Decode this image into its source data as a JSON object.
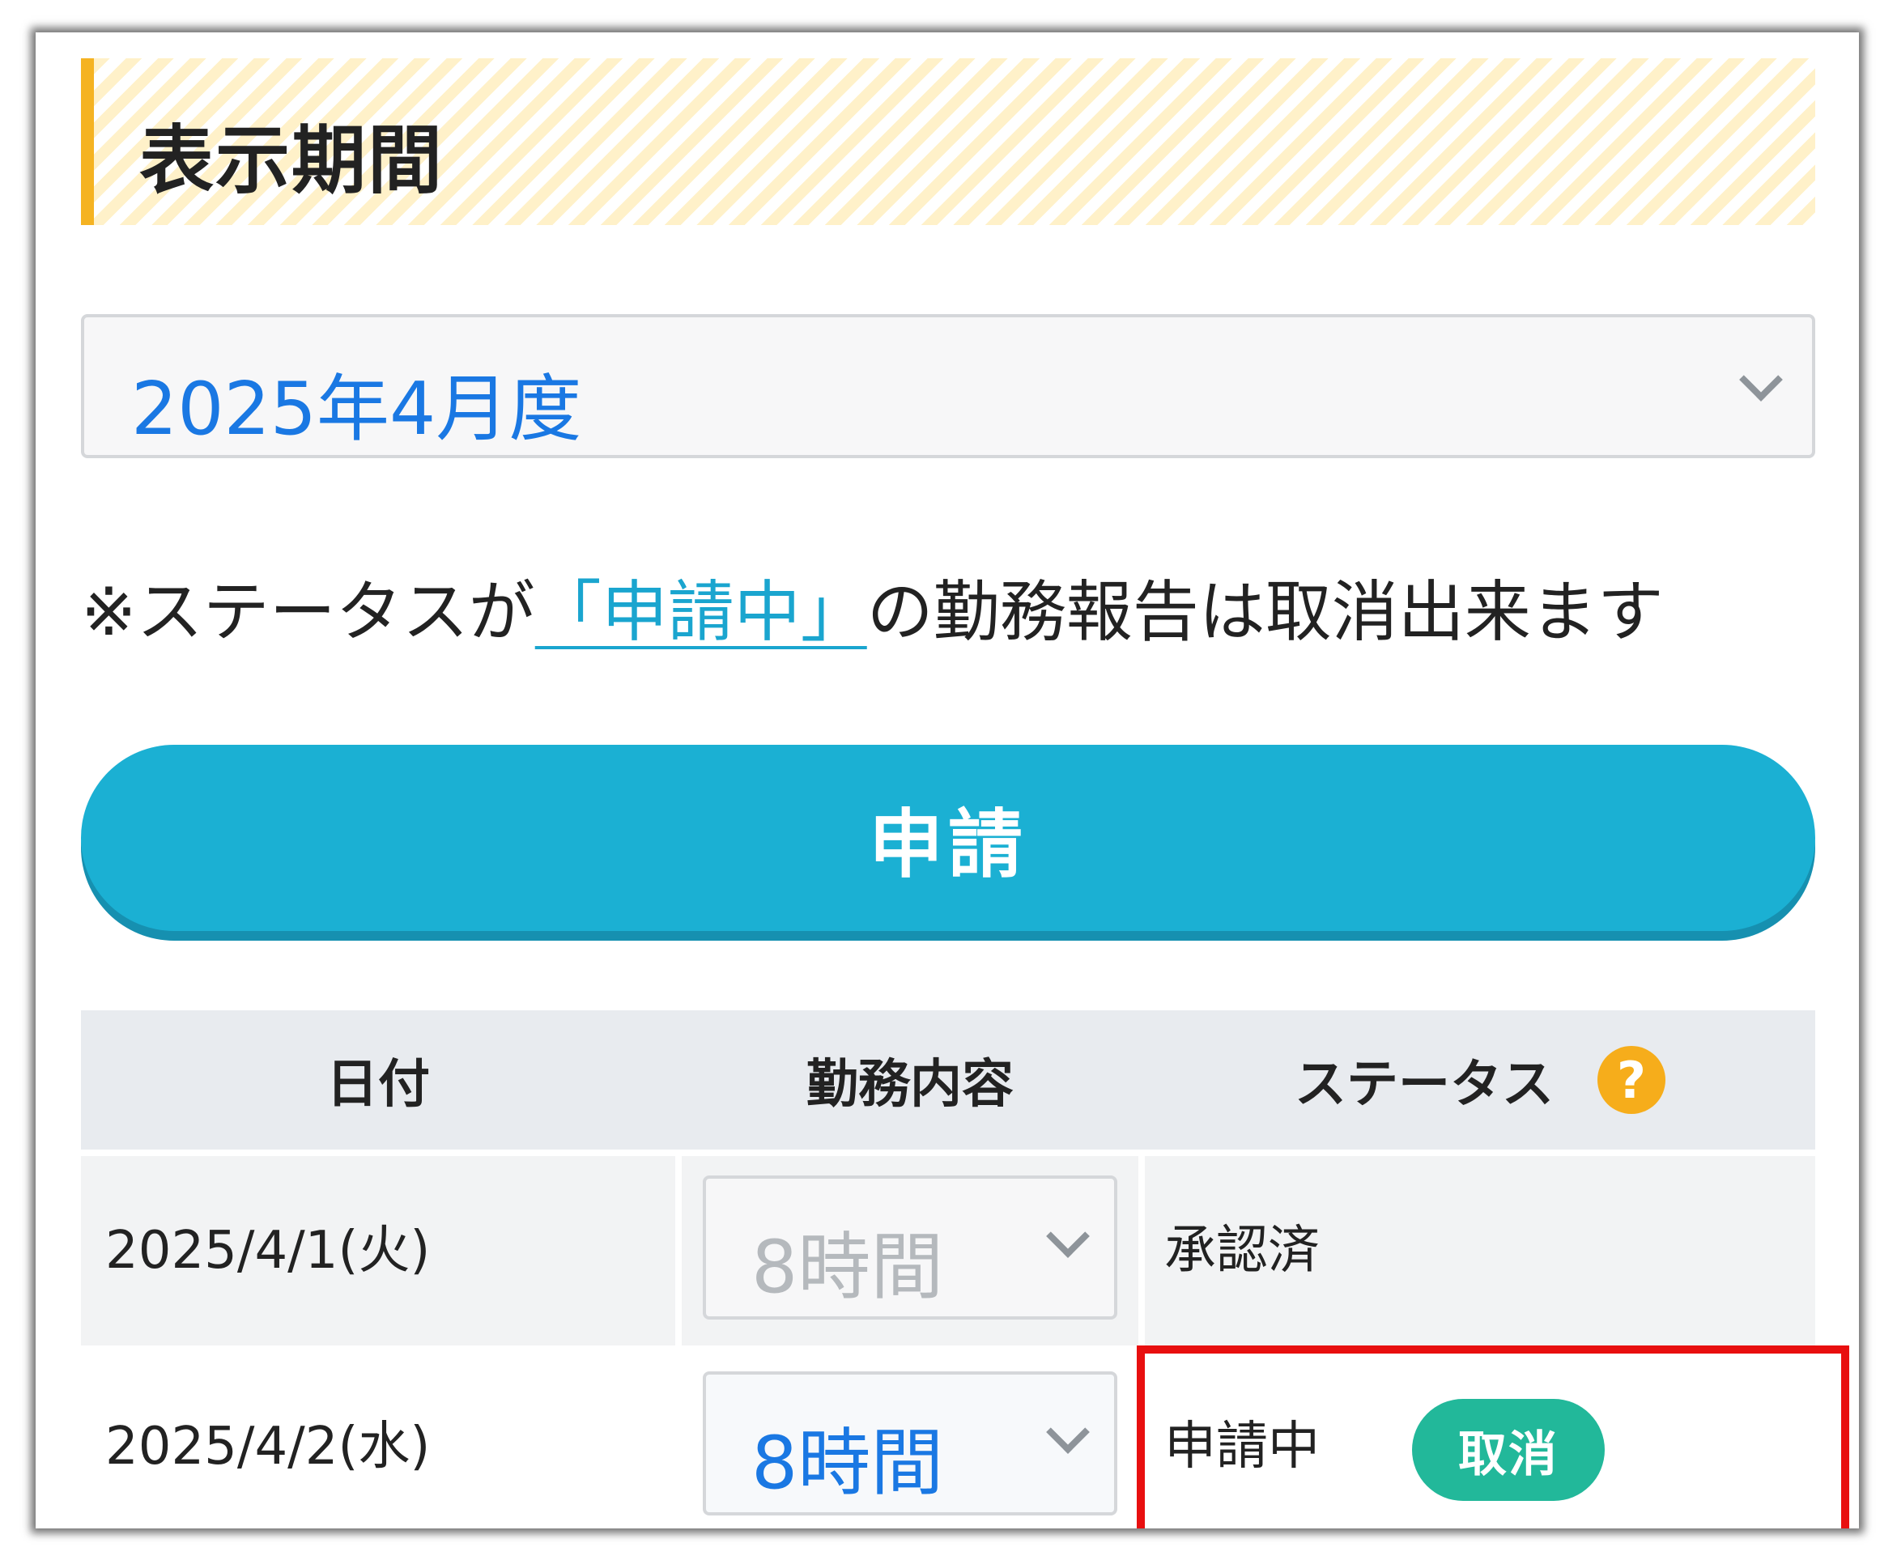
{
  "section": {
    "title": "表示期間"
  },
  "period_select": {
    "value": "2025年4月度"
  },
  "notice": {
    "prefix": "※ステータスが",
    "link": "「申請中」",
    "suffix": "の勤務報告は取消出来ます"
  },
  "apply_button": {
    "label": "申請"
  },
  "table": {
    "headers": {
      "date": "日付",
      "work": "勤務内容",
      "status": "ステータス",
      "help_icon": "?"
    },
    "rows": [
      {
        "date": "2025/4/1(火)",
        "hours": "8時間",
        "status": "承認済"
      },
      {
        "date": "2025/4/2(水)",
        "hours": "8時間",
        "status": "申請中",
        "action": "取消"
      }
    ]
  },
  "colors": {
    "accent_yellow": "#f5b322",
    "primary_blue": "#1bb0d3",
    "link_blue": "#1aa5cf",
    "select_text_blue": "#1a78e3",
    "cancel_green": "#22b89a",
    "help_orange": "#f6ad1b",
    "highlight_red": "#e80f0f"
  }
}
